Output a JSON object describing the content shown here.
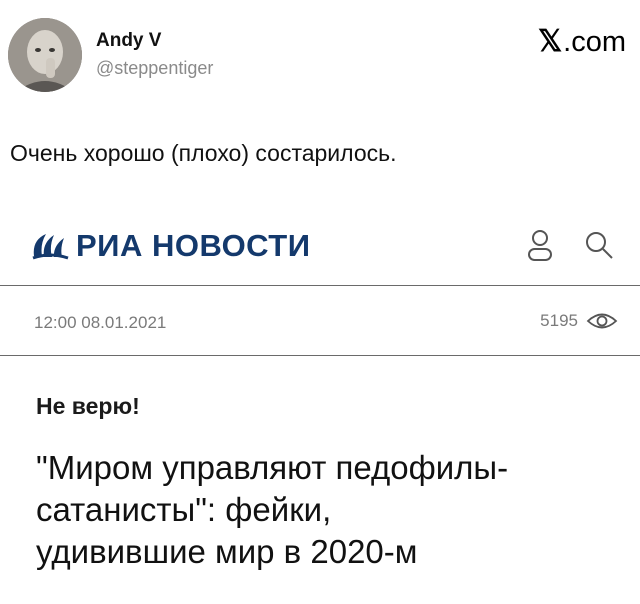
{
  "tweet": {
    "author_name": "Andy V",
    "author_handle": "@steppentiger",
    "source": {
      "icon": "x-logo-icon",
      "domain_text": ".com"
    },
    "text": "Очень хорошо (плохо) состарилось."
  },
  "article": {
    "site_name": "РИА НОВОСТИ",
    "logo_icon": "ria-globe-icon",
    "brand_color": "#14396c",
    "header_icons": [
      "user-icon",
      "search-icon"
    ],
    "timestamp": "12:00 08.01.2021",
    "views": "5195",
    "views_icon": "eye-icon",
    "tag": "Не верю!",
    "title_lines": [
      "\"Миром управляют педофилы-",
      "сатанисты\": фейки,",
      "удивившие мир в 2020-м"
    ]
  }
}
